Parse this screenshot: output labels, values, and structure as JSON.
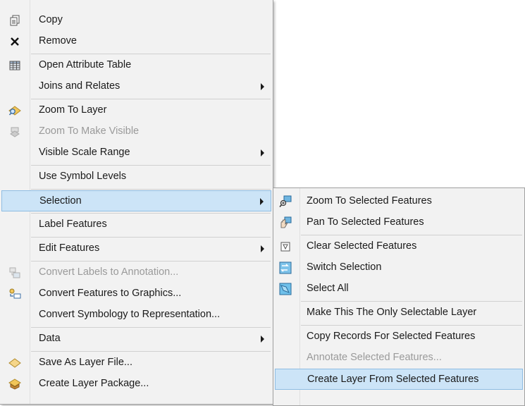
{
  "main_menu": {
    "items": [
      {
        "label": "Copy",
        "icon": "copy-icon"
      },
      {
        "label": "Remove",
        "icon": "remove-x-icon"
      },
      {
        "label": "Open Attribute Table",
        "icon": "table-icon"
      },
      {
        "label": "Joins and Relates",
        "submenu": true
      },
      {
        "label": "Zoom To Layer",
        "icon": "zoom-to-layer-icon"
      },
      {
        "label": "Zoom To Make Visible",
        "icon": "zoom-to-visible-icon",
        "disabled": true
      },
      {
        "label": "Visible Scale Range",
        "submenu": true
      },
      {
        "label": "Use Symbol Levels"
      },
      {
        "label": "Selection",
        "submenu": true,
        "highlighted": true
      },
      {
        "label": "Label Features"
      },
      {
        "label": "Edit Features",
        "submenu": true
      },
      {
        "label": "Convert Labels to Annotation...",
        "icon": "convert-labels-icon",
        "disabled": true
      },
      {
        "label": "Convert Features to Graphics...",
        "icon": "convert-graphics-icon"
      },
      {
        "label": "Convert Symbology to Representation..."
      },
      {
        "label": "Data",
        "submenu": true
      },
      {
        "label": "Save As Layer File...",
        "icon": "layer-file-icon"
      },
      {
        "label": "Create Layer Package...",
        "icon": "layer-package-icon"
      }
    ]
  },
  "selection_submenu": {
    "items": [
      {
        "label": "Zoom To Selected Features",
        "icon": "zoom-selected-icon"
      },
      {
        "label": "Pan To Selected Features",
        "icon": "pan-selected-icon"
      },
      {
        "label": "Clear Selected Features",
        "icon": "clear-selection-icon"
      },
      {
        "label": "Switch Selection",
        "icon": "switch-selection-icon"
      },
      {
        "label": "Select All",
        "icon": "select-all-icon"
      },
      {
        "label": "Make This The Only Selectable Layer"
      },
      {
        "label": "Copy Records For Selected Features"
      },
      {
        "label": "Annotate Selected Features...",
        "disabled": true
      },
      {
        "label": "Create Layer From Selected Features",
        "highlighted": true
      }
    ]
  },
  "colors": {
    "menu_bg": "#f2f2f2",
    "highlight_bg": "#cce4f7",
    "highlight_border": "#8fbde3",
    "disabled_text": "#9a9a9a"
  }
}
